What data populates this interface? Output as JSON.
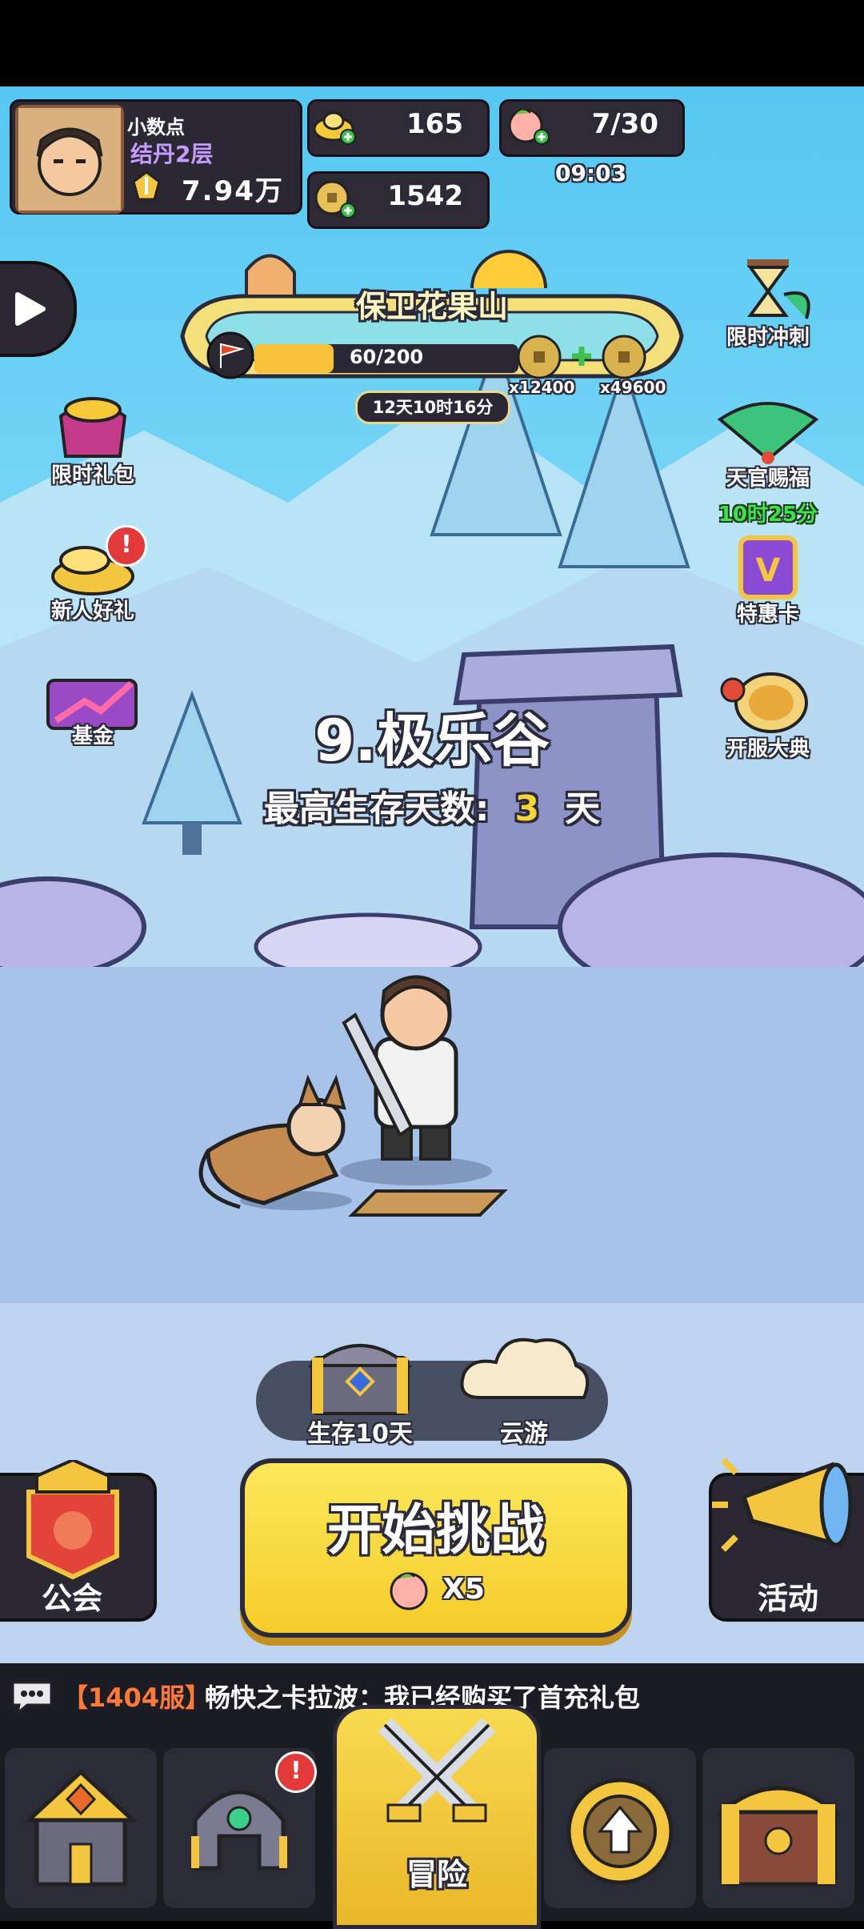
{
  "player": {
    "name": "小数点",
    "realm": "结丹2层",
    "power": "7.94万"
  },
  "resources": {
    "gold_ingot": "165",
    "peach_stamina": "7/30",
    "stamina_timer": "09:03",
    "coins": "1542"
  },
  "event_banner": {
    "title": "保卫花果山",
    "progress_text": "60/200",
    "progress_fraction": 0.3,
    "reward_1": "x12400",
    "reward_2": "x49600",
    "countdown": "12天10时16分"
  },
  "left_menu": [
    {
      "label": "限时礼包"
    },
    {
      "label": "新人好礼"
    },
    {
      "label": "基金"
    }
  ],
  "right_menu": [
    {
      "label": "限时冲刺"
    },
    {
      "label": "天官赐福",
      "timer": "10时25分"
    },
    {
      "label": "特惠卡"
    },
    {
      "label": "开服大典"
    }
  ],
  "stage": {
    "name": "9.极乐谷",
    "best_label": "最高生存天数:",
    "best_days": "3",
    "days_unit": "天"
  },
  "mode_row": {
    "chest_label": "生存10天",
    "cloud_label": "云游"
  },
  "main_actions": {
    "guild_label": "公会",
    "start_label": "开始挑战",
    "cost_label": "X5",
    "activity_label": "活动"
  },
  "chat": {
    "server": "【1404服】",
    "message": "畅快之卡拉波：我已经购买了首充礼包"
  },
  "bottom_nav": {
    "center_label": "冒险"
  },
  "colors": {
    "gold": "#f6d43a",
    "green_timer": "#3ee24a",
    "chat_server": "#ff7a3a"
  }
}
